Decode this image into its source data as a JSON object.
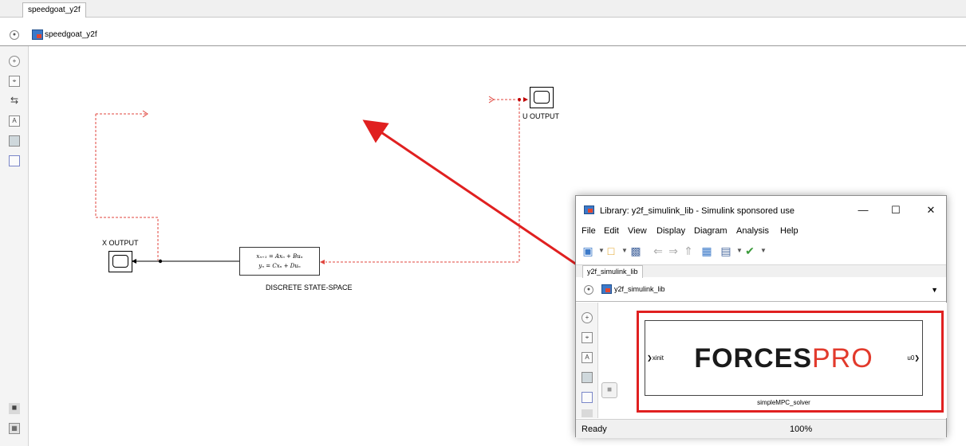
{
  "main_window": {
    "tab_label": "speedgoat_y2f",
    "address": "speedgoat_y2f",
    "toolbar_icons": [
      "zoom-in-icon",
      "fit-view-icon",
      "arrow-right-icon",
      "annotation-icon",
      "image-icon",
      "rectangle-icon",
      "camera-icon",
      "screenshot-icon"
    ]
  },
  "diagram": {
    "x_output_label": "X OUTPUT",
    "u_output_label": "U OUTPUT",
    "ss_block_label": "DISCRETE STATE-SPACE",
    "ss_eq1": "xₙ₊₁ = Axₙ + Buₙ",
    "ss_eq2": "yₙ = Cxₙ + Duₙ",
    "colors": {
      "signal_dashed": "#e0453d",
      "arrow": "#e02020",
      "line": "#000000"
    }
  },
  "library_window": {
    "title": "Library: y2f_simulink_lib - Simulink sponsored use",
    "minimize": "—",
    "maximize": "☐",
    "close": "✕",
    "menus": [
      "File",
      "Edit",
      "View",
      "Display",
      "Diagram",
      "Analysis",
      "Help"
    ],
    "tab_label": "y2f_simulink_lib",
    "address": "y2f_simulink_lib",
    "block": {
      "logo_part1": "FORCES",
      "logo_part2": "PRO",
      "input_port": "xinit",
      "output_port": "u0",
      "name": "simpleMPC_solver"
    },
    "status": "Ready",
    "zoom": "100%"
  }
}
